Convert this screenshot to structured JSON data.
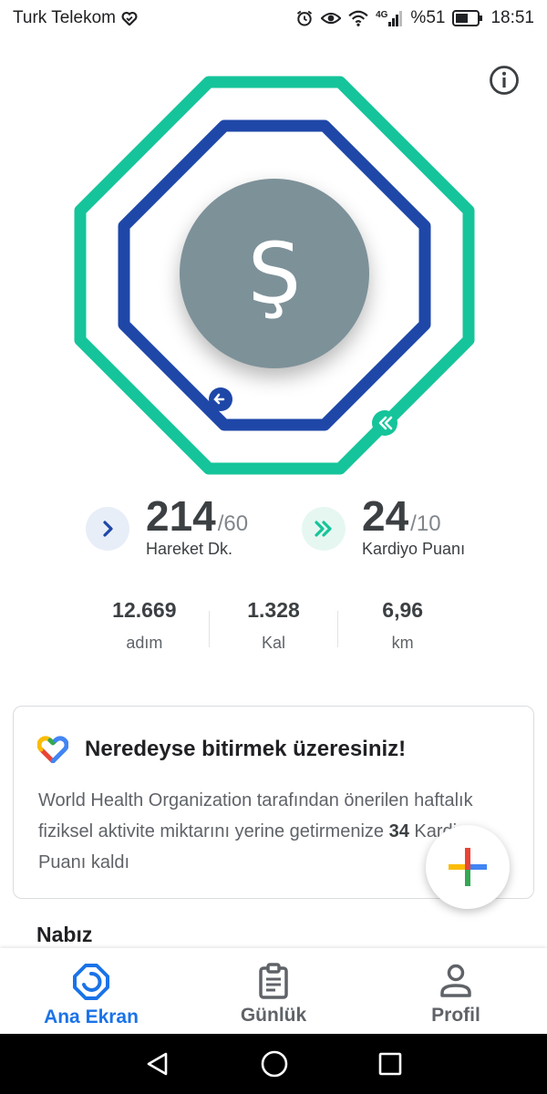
{
  "status_bar": {
    "carrier": "Turk Telekom",
    "battery": "%51",
    "time": "18:51",
    "network": "4G"
  },
  "rings": {
    "avatar_letter": "Ş",
    "move_color": "#1e47a8",
    "heart_color": "#15c49a",
    "move_progress": 1.0,
    "heart_progress": 1.0
  },
  "goals": {
    "move": {
      "value": "214",
      "target": "/60",
      "label": "Hareket Dk.",
      "icon": "chevron-right-icon"
    },
    "heart": {
      "value": "24",
      "target": "/10",
      "label": "Kardiyo Puanı",
      "icon": "double-chevron-right-icon"
    }
  },
  "stats": [
    {
      "value": "12.669",
      "unit": "adım"
    },
    {
      "value": "1.328",
      "unit": "Kal"
    },
    {
      "value": "6,96",
      "unit": "km"
    }
  ],
  "card": {
    "title": "Neredeyse bitirmek üzeresiniz!",
    "body_before": "World Health Organization tarafından önerilen haftalık fiziksel aktivite miktarını yerine getirmenize ",
    "body_bold": "34",
    "body_after": " Kardiyo Puanı kaldı"
  },
  "next_section_title": "Nabız",
  "bottom_nav": [
    {
      "label": "Ana Ekran",
      "icon": "home-ring-icon",
      "active": true
    },
    {
      "label": "Günlük",
      "icon": "clipboard-icon",
      "active": false
    },
    {
      "label": "Profil",
      "icon": "person-icon",
      "active": false
    }
  ],
  "colors": {
    "accent_blue": "#1a73e8",
    "move_blue": "#1e47a8",
    "heart_green": "#15c49a"
  }
}
